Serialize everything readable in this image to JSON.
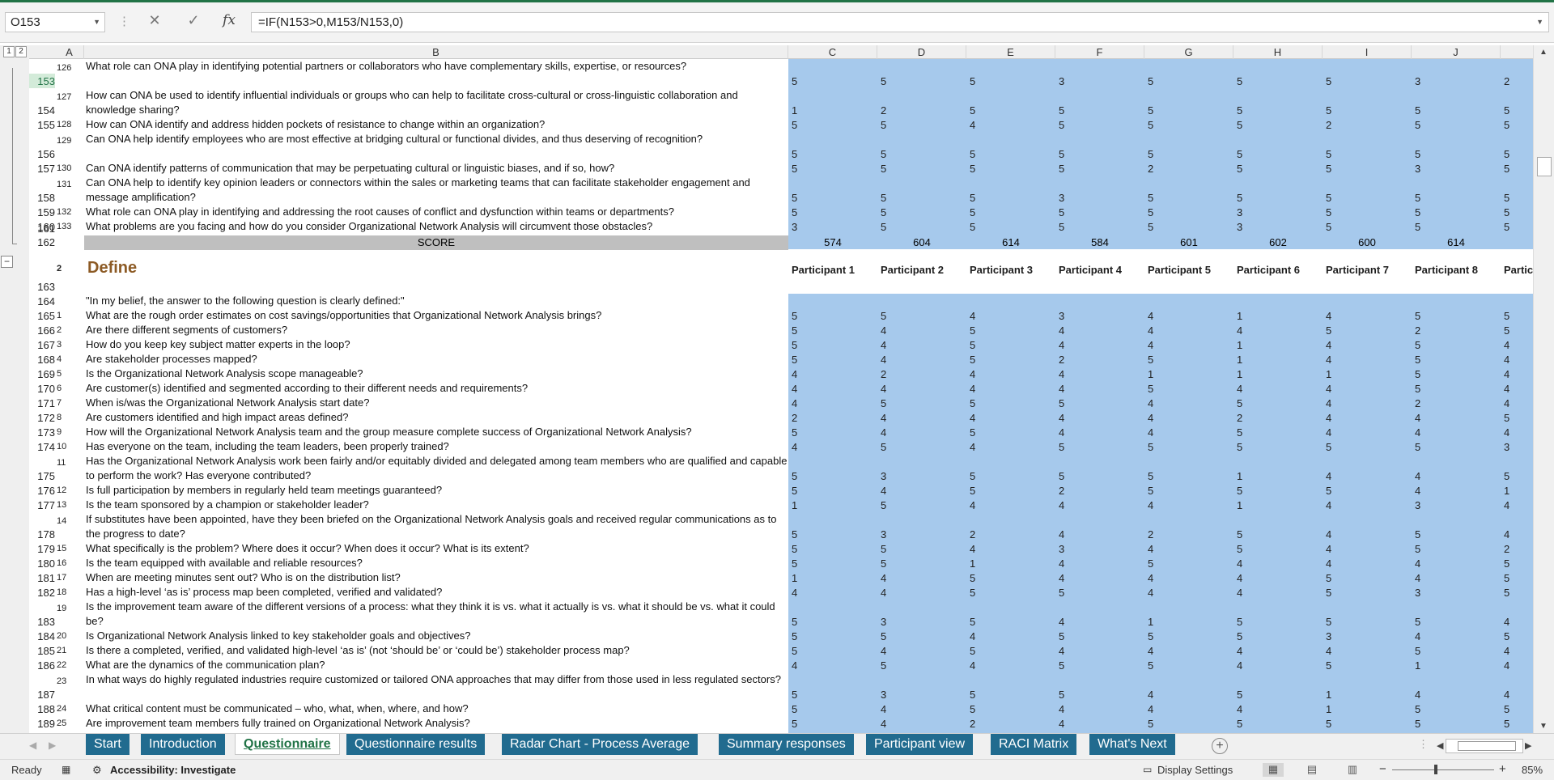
{
  "formula_bar": {
    "name_box": "O153",
    "formula": "=IF(N153>0,M153/N153,0)",
    "cancel_icon": "close-icon",
    "enter_icon": "check-icon",
    "fx_label": "fx"
  },
  "outline_levels": [
    "1",
    "2"
  ],
  "columns": [
    "A",
    "B",
    "C",
    "D",
    "E",
    "F",
    "G",
    "H",
    "I",
    "J"
  ],
  "rows_top": [
    {
      "row": "153",
      "a": "126",
      "q": "What role can ONA play in identifying potential partners or collaborators who have complementary skills, expertise, or resources?",
      "v": [
        "5",
        "5",
        "5",
        "3",
        "5",
        "5",
        "5",
        "3",
        "2"
      ]
    },
    {
      "row": "154",
      "a": "127",
      "q": "How can ONA be used to identify influential individuals or groups who can help to facilitate cross-cultural or cross-linguistic collaboration and knowledge sharing?",
      "v": [
        "1",
        "2",
        "5",
        "5",
        "5",
        "5",
        "5",
        "5",
        "5"
      ]
    },
    {
      "row": "155",
      "a": "128",
      "q": "How can ONA identify and address hidden pockets of resistance to change within an organization?",
      "v": [
        "5",
        "5",
        "4",
        "5",
        "5",
        "5",
        "2",
        "5",
        "5"
      ]
    },
    {
      "row": "156",
      "a": "129",
      "q": "Can ONA help identify employees who are most effective at bridging cultural or functional divides, and thus deserving of recognition?",
      "v": [
        "5",
        "5",
        "5",
        "5",
        "5",
        "5",
        "5",
        "5",
        "5"
      ]
    },
    {
      "row": "157",
      "a": "130",
      "q": "Can ONA identify patterns of communication that may be perpetuating cultural or linguistic biases, and if so, how?",
      "v": [
        "5",
        "5",
        "5",
        "5",
        "2",
        "5",
        "5",
        "3",
        "5"
      ]
    },
    {
      "row": "158",
      "a": "131",
      "q": "Can ONA help to identify key opinion leaders or connectors within the sales or marketing teams that can facilitate stakeholder engagement and message amplification?",
      "v": [
        "5",
        "5",
        "5",
        "3",
        "5",
        "5",
        "5",
        "5",
        "5"
      ]
    },
    {
      "row": "159",
      "a": "132",
      "q": "What role can ONA play in identifying and addressing the root causes of conflict and dysfunction within teams or departments?",
      "v": [
        "5",
        "5",
        "5",
        "5",
        "5",
        "3",
        "5",
        "5",
        "5"
      ]
    },
    {
      "row": "160",
      "a": "133",
      "q": "What problems are you facing and how do you consider Organizational Network Analysis will circumvent those obstacles?",
      "v": [
        "3",
        "5",
        "5",
        "5",
        "5",
        "3",
        "5",
        "5",
        "5"
      ]
    }
  ],
  "row_161": "161",
  "score_row": {
    "row": "162",
    "label": "SCORE",
    "values": [
      "574",
      "604",
      "614",
      "584",
      "601",
      "602",
      "600",
      "614"
    ]
  },
  "define_section": {
    "outline_num": "2",
    "title": "Define",
    "participants": [
      "Participant 1",
      "Participant 2",
      "Participant 3",
      "Participant 4",
      "Participant 5",
      "Participant 6",
      "Participant 7",
      "Participant 8",
      "Partic"
    ]
  },
  "row_163": "163",
  "intro_row": {
    "row": "164",
    "text": "\"In my belief, the answer to the following question is clearly defined:\""
  },
  "rows_define": [
    {
      "row": "165",
      "a": "1",
      "q": "What are the rough order estimates on cost savings/opportunities that Organizational Network Analysis brings?",
      "v": [
        "5",
        "5",
        "4",
        "3",
        "4",
        "1",
        "4",
        "5",
        "5"
      ]
    },
    {
      "row": "166",
      "a": "2",
      "q": "Are there different segments of customers?",
      "v": [
        "5",
        "4",
        "5",
        "4",
        "4",
        "4",
        "5",
        "2",
        "5"
      ]
    },
    {
      "row": "167",
      "a": "3",
      "q": "How do you keep key subject matter experts in the loop?",
      "v": [
        "5",
        "4",
        "5",
        "4",
        "4",
        "1",
        "4",
        "5",
        "4"
      ]
    },
    {
      "row": "168",
      "a": "4",
      "q": "Are stakeholder processes mapped?",
      "v": [
        "5",
        "4",
        "5",
        "2",
        "5",
        "1",
        "4",
        "5",
        "4"
      ]
    },
    {
      "row": "169",
      "a": "5",
      "q": "Is the Organizational Network Analysis scope manageable?",
      "v": [
        "4",
        "2",
        "4",
        "4",
        "1",
        "1",
        "1",
        "5",
        "4"
      ]
    },
    {
      "row": "170",
      "a": "6",
      "q": "Are customer(s) identified and segmented according to their different needs and requirements?",
      "v": [
        "4",
        "4",
        "4",
        "4",
        "5",
        "4",
        "4",
        "5",
        "4"
      ]
    },
    {
      "row": "171",
      "a": "7",
      "q": "When is/was the Organizational Network Analysis start date?",
      "v": [
        "4",
        "5",
        "5",
        "5",
        "4",
        "5",
        "4",
        "2",
        "4"
      ]
    },
    {
      "row": "172",
      "a": "8",
      "q": "Are customers identified and high impact areas defined?",
      "v": [
        "2",
        "4",
        "4",
        "4",
        "4",
        "2",
        "4",
        "4",
        "5"
      ]
    },
    {
      "row": "173",
      "a": "9",
      "q": "How will the Organizational Network Analysis team and the group measure complete success of Organizational Network Analysis?",
      "v": [
        "5",
        "4",
        "5",
        "4",
        "4",
        "5",
        "4",
        "4",
        "4"
      ]
    },
    {
      "row": "174",
      "a": "10",
      "q": "Has everyone on the team, including the team leaders, been properly trained?",
      "v": [
        "4",
        "5",
        "4",
        "5",
        "5",
        "5",
        "5",
        "5",
        "3"
      ]
    },
    {
      "row": "175",
      "a": "11",
      "q": "Has the Organizational Network Analysis work been fairly and/or equitably divided and delegated among team members who are qualified and capable to perform the work? Has everyone contributed?",
      "v": [
        "5",
        "3",
        "5",
        "5",
        "5",
        "1",
        "4",
        "4",
        "5"
      ]
    },
    {
      "row": "176",
      "a": "12",
      "q": "Is full participation by members in regularly held team meetings guaranteed?",
      "v": [
        "5",
        "4",
        "5",
        "2",
        "5",
        "5",
        "5",
        "4",
        "1"
      ]
    },
    {
      "row": "177",
      "a": "13",
      "q": "Is the team sponsored by a champion or stakeholder leader?",
      "v": [
        "1",
        "5",
        "4",
        "4",
        "4",
        "1",
        "4",
        "3",
        "4"
      ]
    },
    {
      "row": "178",
      "a": "14",
      "q": "If substitutes have been appointed, have they been briefed on the Organizational Network Analysis goals and received regular communications as to the progress to date?",
      "v": [
        "5",
        "3",
        "2",
        "4",
        "2",
        "5",
        "4",
        "5",
        "4"
      ]
    },
    {
      "row": "179",
      "a": "15",
      "q": "What specifically is the problem? Where does it occur? When does it occur? What is its extent?",
      "v": [
        "5",
        "5",
        "4",
        "3",
        "4",
        "5",
        "4",
        "5",
        "2"
      ]
    },
    {
      "row": "180",
      "a": "16",
      "q": "Is the team equipped with available and reliable resources?",
      "v": [
        "5",
        "5",
        "1",
        "4",
        "5",
        "4",
        "4",
        "4",
        "5"
      ]
    },
    {
      "row": "181",
      "a": "17",
      "q": "When are meeting minutes sent out? Who is on the distribution list?",
      "v": [
        "1",
        "4",
        "5",
        "4",
        "4",
        "4",
        "5",
        "4",
        "5"
      ]
    },
    {
      "row": "182",
      "a": "18",
      "q": "Has a high-level ‘as is’ process map been completed, verified and validated?",
      "v": [
        "4",
        "4",
        "5",
        "5",
        "4",
        "4",
        "5",
        "3",
        "5"
      ]
    },
    {
      "row": "183",
      "a": "19",
      "q": "Is the improvement team aware of the different versions of a process: what they think it is vs. what it actually is vs. what it should be vs. what it could be?",
      "v": [
        "5",
        "3",
        "5",
        "4",
        "1",
        "5",
        "5",
        "5",
        "4"
      ]
    },
    {
      "row": "184",
      "a": "20",
      "q": "Is Organizational Network Analysis linked to key stakeholder goals and objectives?",
      "v": [
        "5",
        "5",
        "4",
        "5",
        "5",
        "5",
        "3",
        "4",
        "5"
      ]
    },
    {
      "row": "185",
      "a": "21",
      "q": "Is there a completed, verified, and validated high-level ‘as is’ (not ‘should be’ or ‘could be’) stakeholder process map?",
      "v": [
        "5",
        "4",
        "5",
        "4",
        "4",
        "4",
        "4",
        "5",
        "4"
      ]
    },
    {
      "row": "186",
      "a": "22",
      "q": "What are the dynamics of the communication plan?",
      "v": [
        "4",
        "5",
        "4",
        "5",
        "5",
        "4",
        "5",
        "1",
        "4"
      ]
    },
    {
      "row": "187",
      "a": "23",
      "q": "In what ways do highly regulated industries require customized or tailored ONA approaches that may differ from those used in less regulated sectors?",
      "v": [
        "5",
        "3",
        "5",
        "5",
        "4",
        "5",
        "1",
        "4",
        "4"
      ]
    },
    {
      "row": "188",
      "a": "24",
      "q": "What critical content must be communicated – who, what, when, where, and how?",
      "v": [
        "5",
        "4",
        "5",
        "4",
        "4",
        "4",
        "1",
        "5",
        "5"
      ]
    },
    {
      "row": "189",
      "a": "25",
      "q": "Are improvement team members fully trained on Organizational Network Analysis?",
      "v": [
        "5",
        "4",
        "2",
        "4",
        "5",
        "5",
        "5",
        "5",
        "5"
      ]
    }
  ],
  "sheet_tabs": [
    "Start",
    "Introduction",
    "Questionnaire",
    "Questionnaire results",
    "Radar Chart - Process Average",
    "Summary responses",
    "Participant view",
    "RACI Matrix",
    "What's Next"
  ],
  "active_tab": "Questionnaire",
  "status_bar": {
    "ready": "Ready",
    "accessibility": "Accessibility: Investigate",
    "display_settings": "Display Settings",
    "zoom": "85%"
  },
  "colors": {
    "accent": "#217346",
    "tab": "#216b8f",
    "cell_fill": "#a6c9ec",
    "score_fill": "#bfbfbf",
    "define_title": "#8c5a24"
  }
}
